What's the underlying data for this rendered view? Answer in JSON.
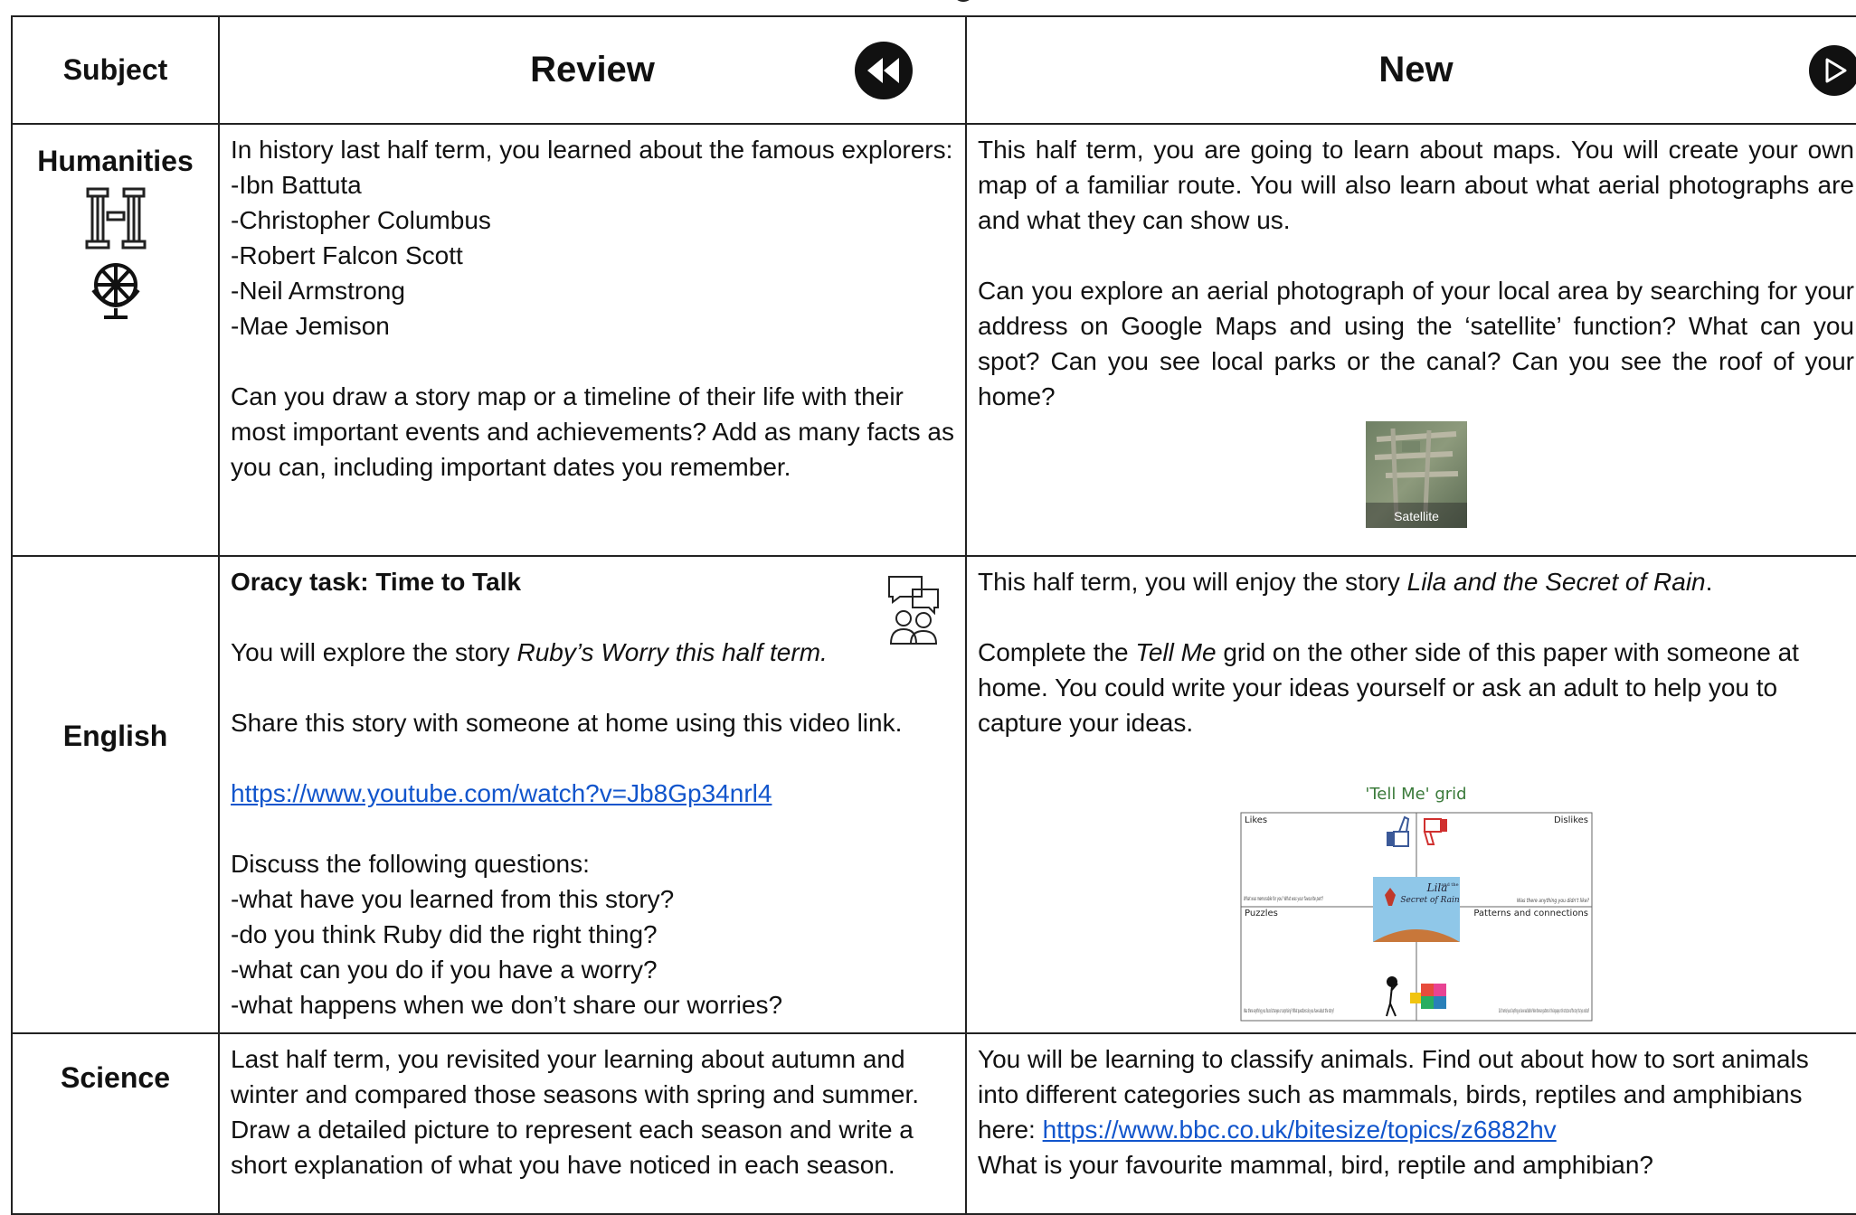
{
  "header": {
    "subject": "Subject",
    "review": "Review",
    "new": "New"
  },
  "icons": {
    "rewind": "rewind-icon",
    "play": "play-icon",
    "humanities": [
      "columns-icon",
      "globe-icon"
    ],
    "talk": "talk-people-icon"
  },
  "rows": {
    "humanities": {
      "subject": "Humanities",
      "review": {
        "p1": "In history last half term, you learned about the famous explorers:",
        "list": [
          "-Ibn Battuta",
          "-Christopher Columbus",
          "-Robert Falcon Scott",
          "-Neil Armstrong",
          "-Mae Jemison"
        ],
        "p2": "Can you draw a story map or a timeline of their life with their most important events and achievements? Add as many facts as you can, including important dates you remember."
      },
      "new": {
        "p1": "This half term, you are going to learn about maps. You will create your own map of a familiar route. You will also learn about what aerial photographs are and what they can show us.",
        "p2": "Can you explore an aerial photograph of your local area by searching for your address on Google Maps and using the ‘satellite’ function? What can you spot? Can you see local parks or the canal? Can you see the roof of your home?",
        "satellite_label": "Satellite"
      }
    },
    "english": {
      "subject": "English",
      "review": {
        "title": "Oracy task: Time to Talk",
        "p1_prefix": "You will explore the story ",
        "p1_italic": "Ruby’s Worry this half term.",
        "p2": "Share this story with someone at home using this video link.",
        "link": "https://www.youtube.com/watch?v=Jb8Gp34nrl4",
        "p3": "Discuss the following questions:",
        "questions": [
          "-what have you learned from this story?",
          "-do you think Ruby did the right thing?",
          "-what can you do if you have a worry?",
          "-what happens when we don’t share our worries?"
        ]
      },
      "new": {
        "p1_prefix": "This half term, you will enjoy the story ",
        "p1_italic": "Lila and the Secret of Rain",
        "p1_suffix": ".",
        "p2_prefix": "Complete the ",
        "p2_italic": "Tell Me",
        "p2_suffix": " grid on the other side of this paper with someone at home. You could write your ideas yourself or ask an adult to help you to capture your ideas.",
        "grid": {
          "title": "'Tell Me' grid",
          "likes": "Likes",
          "dislikes": "Dislikes",
          "puzzles": "Puzzles",
          "patterns": "Patterns and connections",
          "book_title1": "Lila",
          "book_title2": "and the",
          "book_title3": "Secret of Rain",
          "q_likes": "What was memorable for you? What was your favourite part?",
          "q_dislikes": "Was there anything you didn't like?",
          "q_puzzles": "Was there anything you found strange or surprising? What questions do you have about the story?",
          "q_patterns": "Did it remind you of anything you have read before? Were there any patterns in the language or the structure of the story that you noticed?"
        }
      }
    },
    "science": {
      "subject": "Science",
      "review": {
        "p1": "Last half term, you revisited your learning about autumn and winter and compared those seasons with spring and summer. Draw a detailed picture to represent each season and write a short explanation of what you have noticed in each season."
      },
      "new": {
        "p1": "You will be learning to classify animals. Find out about how to sort animals into different categories such as mammals, birds, reptiles and amphibians here: ",
        "link": "https://www.bbc.co.uk/bitesize/topics/z6882hv",
        "p2": "What is your favourite mammal, bird, reptile and amphibian?"
      }
    }
  }
}
